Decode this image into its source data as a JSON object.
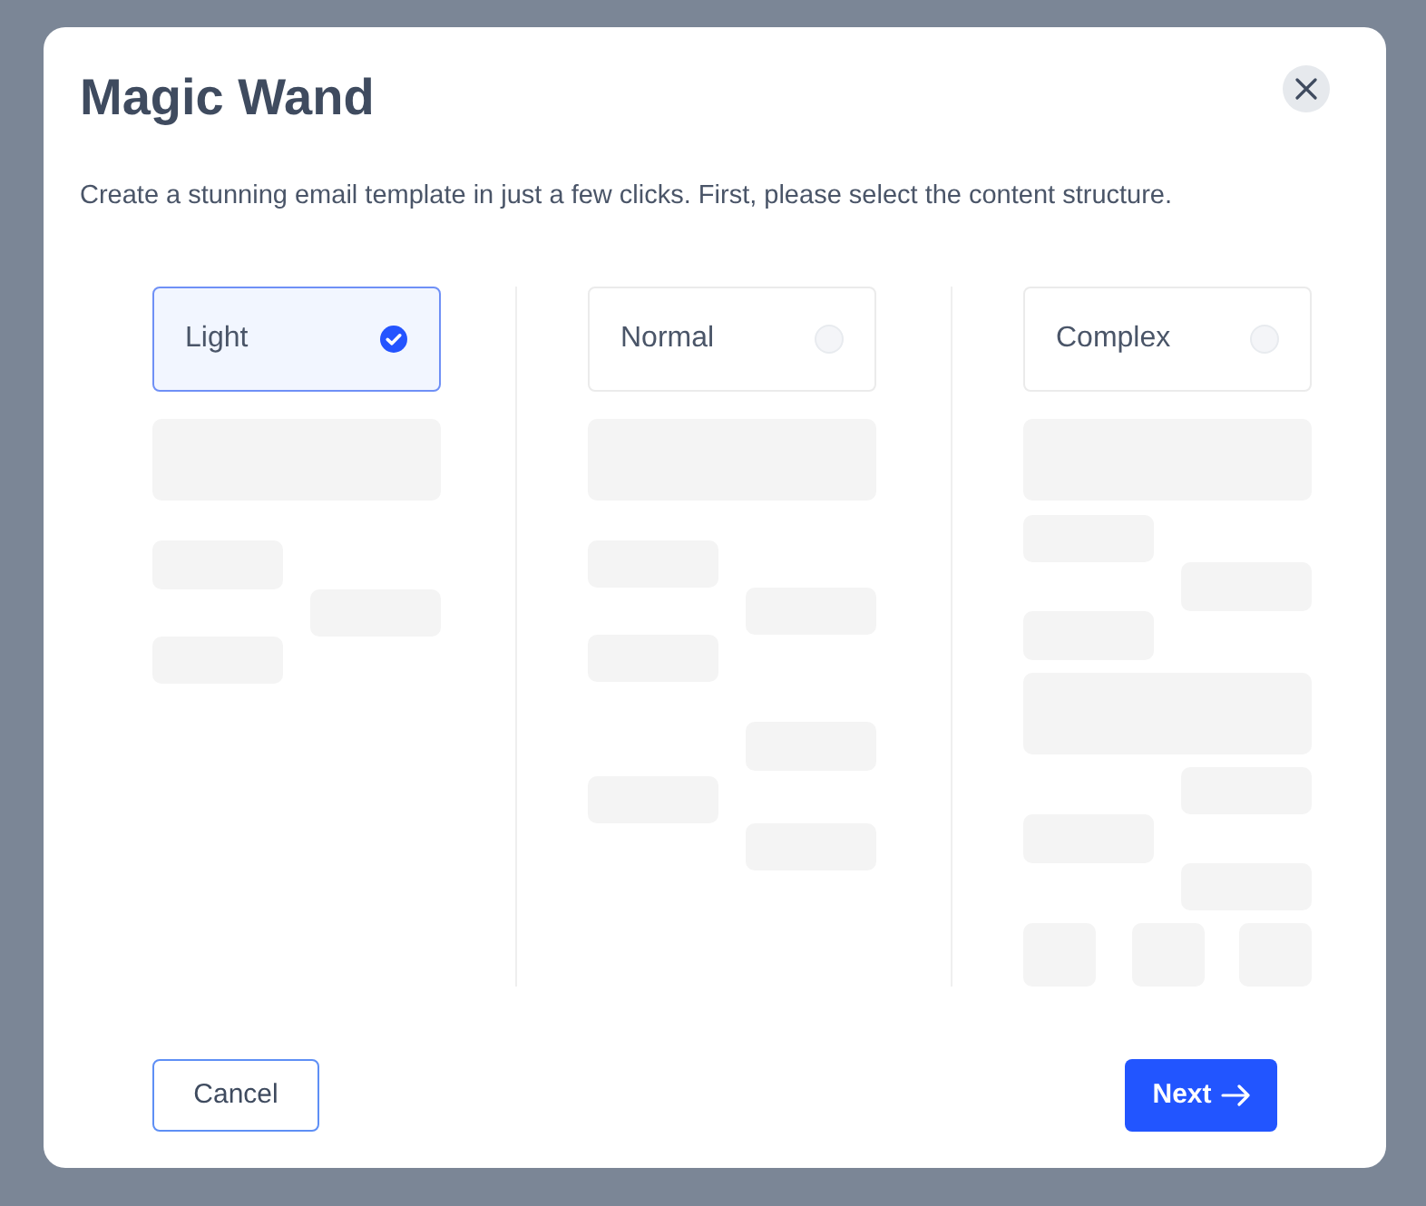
{
  "dialog": {
    "title": "Magic Wand",
    "description": "Create a stunning email template in just a few clicks. First, please select the content structure.",
    "options": [
      {
        "label": "Light",
        "kind": "light",
        "selected": true
      },
      {
        "label": "Normal",
        "kind": "normal",
        "selected": false
      },
      {
        "label": "Complex",
        "kind": "complex",
        "selected": false
      }
    ],
    "buttons": [
      {
        "label": "Cancel",
        "kind": "secondary"
      },
      {
        "label": "Next",
        "kind": "primary"
      }
    ]
  }
}
